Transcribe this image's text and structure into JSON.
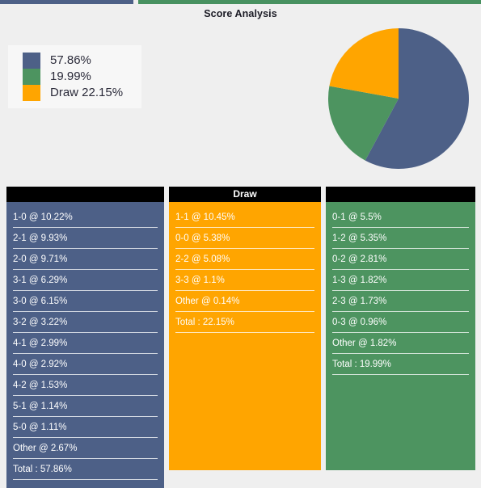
{
  "title": "Score Analysis",
  "colors": {
    "home": "#4d6087",
    "draw": "#FFA500",
    "away": "#4d9460",
    "background": "#efefef",
    "header": "#000000"
  },
  "legend": {
    "items": [
      {
        "swatch": "home-swatch",
        "color": "#4d6087",
        "label": "57.86%"
      },
      {
        "swatch": "away-swatch",
        "color": "#4d9460",
        "label": "19.99%"
      },
      {
        "swatch": "draw-swatch",
        "color": "#FFA500",
        "label": "Draw 22.15%"
      }
    ]
  },
  "chart_data": {
    "type": "pie",
    "title": "Score Analysis",
    "labels": [
      "57.86%",
      "19.99%",
      "Draw 22.15%"
    ],
    "values": [
      57.86,
      19.99,
      22.15
    ],
    "colors": [
      "#4d6087",
      "#4d9460",
      "#FFA500"
    ],
    "start_angle": 0,
    "direction": "clockwise",
    "legend": "upper left",
    "grid": false
  },
  "columns": [
    {
      "key": "home",
      "header": "",
      "color": "#4d6087",
      "rows": [
        "1-0 @ 10.22%",
        "2-1 @ 9.93%",
        "2-0 @ 9.71%",
        "3-1 @ 6.29%",
        "3-0 @ 6.15%",
        "3-2 @ 3.22%",
        "4-1 @ 2.99%",
        "4-0 @ 2.92%",
        "4-2 @ 1.53%",
        "5-1 @ 1.14%",
        "5-0 @ 1.11%",
        "Other @ 2.67%",
        "Total : 57.86%"
      ]
    },
    {
      "key": "draw",
      "header": "Draw",
      "color": "#FFA500",
      "rows": [
        "1-1 @ 10.45%",
        "0-0 @ 5.38%",
        "2-2 @ 5.08%",
        "3-3 @ 1.1%",
        "Other @ 0.14%",
        "Total : 22.15%"
      ]
    },
    {
      "key": "away",
      "header": "",
      "color": "#4d9460",
      "rows": [
        "0-1 @ 5.5%",
        "1-2 @ 5.35%",
        "0-2 @ 2.81%",
        "1-3 @ 1.82%",
        "2-3 @ 1.73%",
        "0-3 @ 0.96%",
        "Other @ 1.82%",
        "Total : 19.99%"
      ]
    }
  ]
}
